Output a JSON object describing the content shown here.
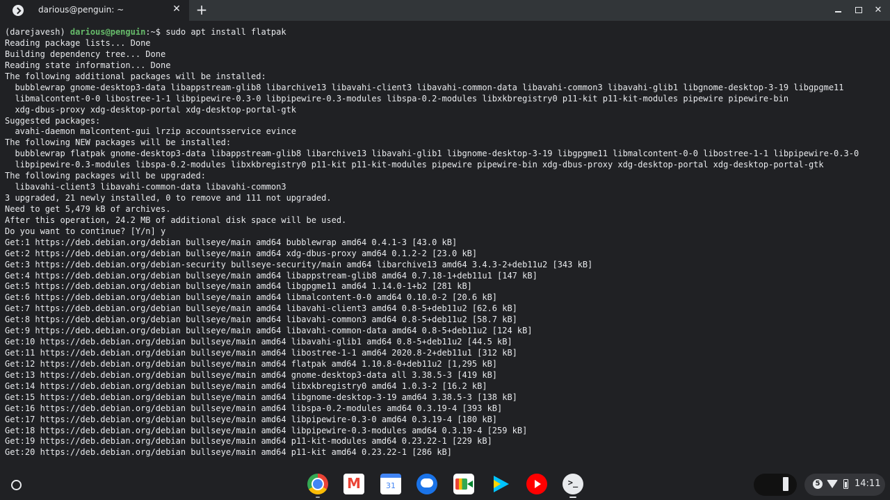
{
  "window": {
    "tab_title": "darious@penguin: ~",
    "tab_close": "✕",
    "new_tab": "+"
  },
  "terminal": {
    "prompt": {
      "env": "(darejavesh) ",
      "user": "darious@penguin",
      "path": ":~$ sudo apt install flatpak"
    },
    "lines": [
      "Reading package lists... Done",
      "Building dependency tree... Done",
      "Reading state information... Done",
      "The following additional packages will be installed:",
      "  bubblewrap gnome-desktop3-data libappstream-glib8 libarchive13 libavahi-client3 libavahi-common-data libavahi-common3 libavahi-glib1 libgnome-desktop-3-19 libgpgme11",
      "  libmalcontent-0-0 libostree-1-1 libpipewire-0.3-0 libpipewire-0.3-modules libspa-0.2-modules libxkbregistry0 p11-kit p11-kit-modules pipewire pipewire-bin",
      "  xdg-dbus-proxy xdg-desktop-portal xdg-desktop-portal-gtk",
      "Suggested packages:",
      "  avahi-daemon malcontent-gui lrzip accountsservice evince",
      "The following NEW packages will be installed:",
      "  bubblewrap flatpak gnome-desktop3-data libappstream-glib8 libarchive13 libavahi-glib1 libgnome-desktop-3-19 libgpgme11 libmalcontent-0-0 libostree-1-1 libpipewire-0.3-0",
      "  libpipewire-0.3-modules libspa-0.2-modules libxkbregistry0 p11-kit p11-kit-modules pipewire pipewire-bin xdg-dbus-proxy xdg-desktop-portal xdg-desktop-portal-gtk",
      "The following packages will be upgraded:",
      "  libavahi-client3 libavahi-common-data libavahi-common3",
      "3 upgraded, 21 newly installed, 0 to remove and 111 not upgraded.",
      "Need to get 5,479 kB of archives.",
      "After this operation, 24.2 MB of additional disk space will be used.",
      "Do you want to continue? [Y/n] y",
      "Get:1 https://deb.debian.org/debian bullseye/main amd64 bubblewrap amd64 0.4.1-3 [43.0 kB]",
      "Get:2 https://deb.debian.org/debian bullseye/main amd64 xdg-dbus-proxy amd64 0.1.2-2 [23.0 kB]",
      "Get:3 https://deb.debian.org/debian-security bullseye-security/main amd64 libarchive13 amd64 3.4.3-2+deb11u2 [343 kB]",
      "Get:4 https://deb.debian.org/debian bullseye/main amd64 libappstream-glib8 amd64 0.7.18-1+deb11u1 [147 kB]",
      "Get:5 https://deb.debian.org/debian bullseye/main amd64 libgpgme11 amd64 1.14.0-1+b2 [281 kB]",
      "Get:6 https://deb.debian.org/debian bullseye/main amd64 libmalcontent-0-0 amd64 0.10.0-2 [20.6 kB]",
      "Get:7 https://deb.debian.org/debian bullseye/main amd64 libavahi-client3 amd64 0.8-5+deb11u2 [62.6 kB]",
      "Get:8 https://deb.debian.org/debian bullseye/main amd64 libavahi-common3 amd64 0.8-5+deb11u2 [58.7 kB]",
      "Get:9 https://deb.debian.org/debian bullseye/main amd64 libavahi-common-data amd64 0.8-5+deb11u2 [124 kB]",
      "Get:10 https://deb.debian.org/debian bullseye/main amd64 libavahi-glib1 amd64 0.8-5+deb11u2 [44.5 kB]",
      "Get:11 https://deb.debian.org/debian bullseye/main amd64 libostree-1-1 amd64 2020.8-2+deb11u1 [312 kB]",
      "Get:12 https://deb.debian.org/debian bullseye/main amd64 flatpak amd64 1.10.8-0+deb11u2 [1,295 kB]",
      "Get:13 https://deb.debian.org/debian bullseye/main amd64 gnome-desktop3-data all 3.38.5-3 [419 kB]",
      "Get:14 https://deb.debian.org/debian bullseye/main amd64 libxkbregistry0 amd64 1.0.3-2 [16.2 kB]",
      "Get:15 https://deb.debian.org/debian bullseye/main amd64 libgnome-desktop-3-19 amd64 3.38.5-3 [138 kB]",
      "Get:16 https://deb.debian.org/debian bullseye/main amd64 libspa-0.2-modules amd64 0.3.19-4 [393 kB]",
      "Get:17 https://deb.debian.org/debian bullseye/main amd64 libpipewire-0.3-0 amd64 0.3.19-4 [180 kB]",
      "Get:18 https://deb.debian.org/debian bullseye/main amd64 libpipewire-0.3-modules amd64 0.3.19-4 [259 kB]",
      "Get:19 https://deb.debian.org/debian bullseye/main amd64 p11-kit-modules amd64 0.23.22-1 [229 kB]",
      "Get:20 https://deb.debian.org/debian bullseye/main amd64 p11-kit amd64 0.23.22-1 [286 kB]"
    ]
  },
  "shelf": {
    "apps": [
      {
        "name": "chrome-app-icon"
      },
      {
        "name": "gmail-app-icon"
      },
      {
        "name": "calendar-app-icon",
        "label": "31"
      },
      {
        "name": "messages-app-icon"
      },
      {
        "name": "meet-app-icon"
      },
      {
        "name": "play-store-app-icon"
      },
      {
        "name": "youtube-app-icon"
      },
      {
        "name": "terminal-app-icon"
      }
    ],
    "notification_count": "5",
    "clock": "14:11"
  },
  "colors": {
    "terminal_bg": "#202124",
    "titlebar_bg": "#323639",
    "prompt_user": "#66bb6a",
    "text": "#e8eaed"
  }
}
